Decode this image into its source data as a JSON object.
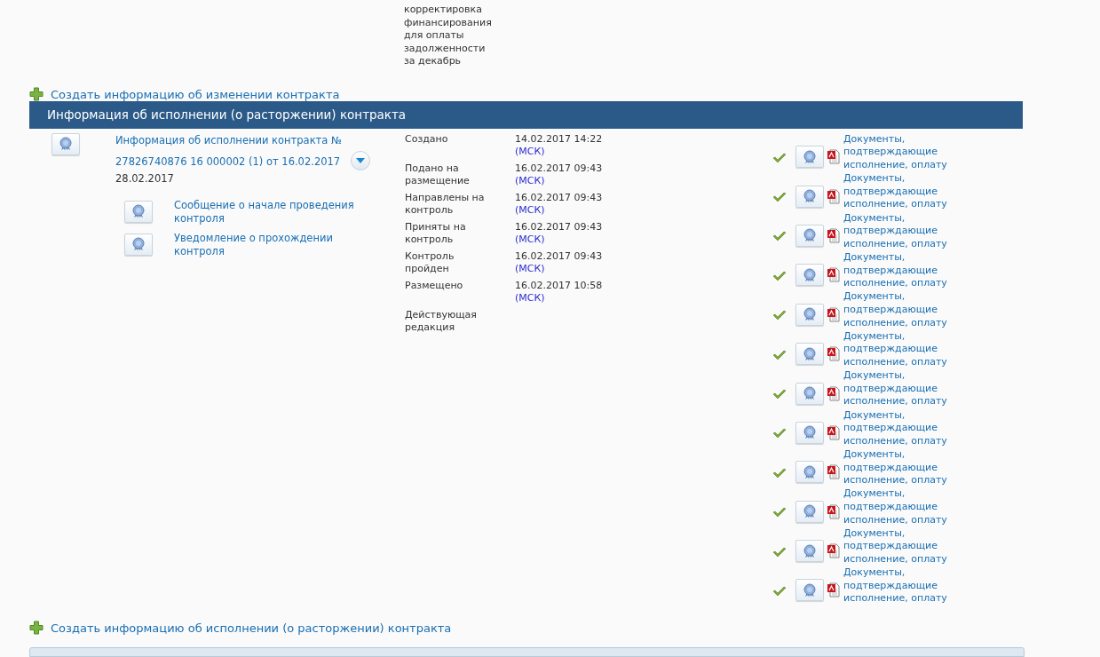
{
  "top_cell": {
    "text": "корректировка\nфинансирования\nдля оплаты\nзадолженности\nза декабрь"
  },
  "create_change_link": "Создать информацию об изменении контракта",
  "section": {
    "title": "Информация об исполнении (о расторжении) контракта"
  },
  "record": {
    "title": "Информация об исполнении контракта №\n27826740876 16 000002 (1) от 16.02.2017",
    "expanded": false,
    "date": "28.02.2017",
    "attachments": [
      {
        "label": "Сообщение о начале проведения\nконтроля"
      },
      {
        "label": "Уведомление о прохождении\nконтроля"
      }
    ],
    "stages": [
      {
        "label": "Создано",
        "date": "14.02.2017 14:22",
        "tz": "(МСК)"
      },
      {
        "label": "Подано на\nразмещение",
        "date": "16.02.2017 09:43",
        "tz": "(МСК)"
      },
      {
        "label": "Направлены на\nконтроль",
        "date": "16.02.2017 09:43",
        "tz": "(МСК)"
      },
      {
        "label": "Приняты на\nконтроль",
        "date": "16.02.2017 09:43",
        "tz": "(МСК)"
      },
      {
        "label": "Контроль\nпройден",
        "date": "16.02.2017 09:43",
        "tz": "(МСК)"
      },
      {
        "label": "Размещено",
        "date": "16.02.2017 10:58",
        "tz": "(МСК)"
      },
      {
        "label": "Действующая\nредакция"
      }
    ],
    "documents": [
      {
        "label": "Документы,\nподтверждающие\nисполнение, оплату",
        "checked": true
      },
      {
        "label": "Документы,\nподтверждающие\nисполнение, оплату",
        "checked": true
      },
      {
        "label": "Документы,\nподтверждающие\nисполнение, оплату",
        "checked": true
      },
      {
        "label": "Документы,\nподтверждающие\nисполнение, оплату",
        "checked": true
      },
      {
        "label": "Документы,\nподтверждающие\nисполнение, оплату",
        "checked": true
      },
      {
        "label": "Документы,\nподтверждающие\nисполнение, оплату",
        "checked": true
      },
      {
        "label": "Документы,\nподтверждающие\nисполнение, оплату",
        "checked": true
      },
      {
        "label": "Документы,\nподтверждающие\nисполнение, оплату",
        "checked": true
      },
      {
        "label": "Документы,\nподтверждающие\nисполнение, оплату",
        "checked": true
      },
      {
        "label": "Документы,\nподтверждающие\nисполнение, оплату",
        "checked": true
      },
      {
        "label": "Документы,\nподтверждающие\nисполнение, оплату",
        "checked": true
      },
      {
        "label": "Документы,\nподтверждающие\nисполнение, оплату",
        "checked": true
      }
    ]
  },
  "create_execution_link": "Создать информацию об исполнении (о расторжении) контракта"
}
